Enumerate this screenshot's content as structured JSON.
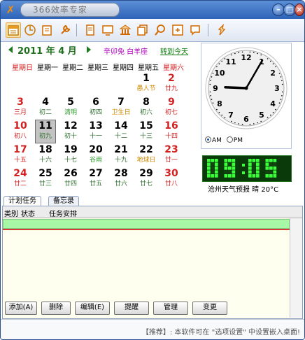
{
  "app": {
    "title": "366效率专家"
  },
  "colors": {
    "accent": "#2f63b8",
    "weekend": "#d42020",
    "green": "#1f6f1f",
    "lcd": "#3bff3b"
  },
  "calendar": {
    "year_month": "2011 年  4 月",
    "lunar_info": "辛卯兔 白羊座",
    "today_link": "转到今天",
    "weekdays": [
      "星期日",
      "星期一",
      "星期二",
      "星期三",
      "星期四",
      "星期五",
      "星期六"
    ],
    "rows": [
      [
        null,
        null,
        null,
        null,
        null,
        {
          "d": "1",
          "l": "愚人节"
        },
        {
          "d": "2",
          "l": "廿九"
        }
      ],
      [
        {
          "d": "3",
          "l": "三月"
        },
        {
          "d": "4",
          "l": "初二"
        },
        {
          "d": "5",
          "l": "清明"
        },
        {
          "d": "6",
          "l": "初四"
        },
        {
          "d": "7",
          "l": "卫生日"
        },
        {
          "d": "8",
          "l": "初六"
        },
        {
          "d": "9",
          "l": "初七"
        }
      ],
      [
        {
          "d": "10",
          "l": "初八"
        },
        {
          "d": "11",
          "l": "初九"
        },
        {
          "d": "12",
          "l": "初十"
        },
        {
          "d": "13",
          "l": "十一"
        },
        {
          "d": "14",
          "l": "十二"
        },
        {
          "d": "15",
          "l": "十三"
        },
        {
          "d": "16",
          "l": "十四"
        }
      ],
      [
        {
          "d": "17",
          "l": "十五"
        },
        {
          "d": "18",
          "l": "十六"
        },
        {
          "d": "19",
          "l": "十七"
        },
        {
          "d": "20",
          "l": "谷雨"
        },
        {
          "d": "21",
          "l": "十九"
        },
        {
          "d": "22",
          "l": "地球日"
        },
        {
          "d": "23",
          "l": "廿一"
        }
      ],
      [
        {
          "d": "24",
          "l": "廿二"
        },
        {
          "d": "25",
          "l": "廿三"
        },
        {
          "d": "26",
          "l": "廿四"
        },
        {
          "d": "27",
          "l": "廿五"
        },
        {
          "d": "28",
          "l": "廿六"
        },
        {
          "d": "29",
          "l": "廿七"
        },
        {
          "d": "30",
          "l": "廿八"
        }
      ]
    ],
    "selected_day": "11"
  },
  "clock": {
    "am": "AM",
    "pm": "PM",
    "selected": "AM",
    "digital": "09:05",
    "hour": 9,
    "minute": 5
  },
  "weather": {
    "text": "沧州天气预报   晴 20°C"
  },
  "tabs": {
    "plan": "计划任务",
    "memo": "备忘录"
  },
  "table": {
    "col_type": "类别",
    "col_status": "状态",
    "col_task": "任务安排"
  },
  "buttons": {
    "add": "添加(A)",
    "delete": "删除",
    "edit": "编辑(E)",
    "remind": "提醒",
    "manage": "管理",
    "change": "变更"
  },
  "footer": {
    "tip": "【推荐】: 本软件可在 \"选项设置\" 中设置嵌入桌面!"
  }
}
